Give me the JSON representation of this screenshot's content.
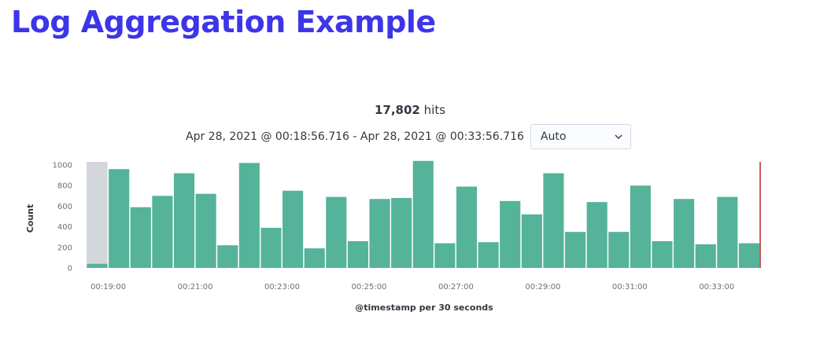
{
  "page": {
    "title": "Log Aggregation Example"
  },
  "summary": {
    "hits_count": "17,802",
    "hits_label": "hits",
    "time_range": "Apr 28, 2021 @ 00:18:56.716 - Apr 28, 2021 @ 00:33:56.716",
    "interval_value": "Auto"
  },
  "colors": {
    "bar": "#54b399",
    "partial_bucket": "#d3d7dc",
    "now_marker": "#bd271e"
  },
  "chart_data": {
    "type": "bar",
    "xlabel": "@timestamp per 30 seconds",
    "ylabel": "Count",
    "ylim": [
      0,
      1000
    ],
    "y_ticks": [
      "0",
      "200",
      "400",
      "600",
      "800",
      "1000"
    ],
    "x_tick_labels": [
      "00:19:00",
      "00:21:00",
      "00:23:00",
      "00:25:00",
      "00:27:00",
      "00:29:00",
      "00:31:00",
      "00:33:00"
    ],
    "categories": [
      "00:18:30",
      "00:19:00",
      "00:19:30",
      "00:20:00",
      "00:20:30",
      "00:21:00",
      "00:21:30",
      "00:22:00",
      "00:22:30",
      "00:23:00",
      "00:23:30",
      "00:24:00",
      "00:24:30",
      "00:25:00",
      "00:25:30",
      "00:26:00",
      "00:26:30",
      "00:27:00",
      "00:27:30",
      "00:28:00",
      "00:28:30",
      "00:29:00",
      "00:29:30",
      "00:30:00",
      "00:30:30",
      "00:31:00",
      "00:31:30",
      "00:32:00",
      "00:32:30",
      "00:33:00",
      "00:33:30"
    ],
    "values": [
      40,
      960,
      590,
      700,
      920,
      720,
      220,
      1020,
      390,
      750,
      190,
      690,
      260,
      670,
      680,
      1040,
      240,
      790,
      250,
      650,
      520,
      920,
      350,
      640,
      350,
      800,
      260,
      670,
      230,
      690,
      240
    ],
    "partial_buckets": [
      "00:18:30"
    ],
    "grid": false
  }
}
